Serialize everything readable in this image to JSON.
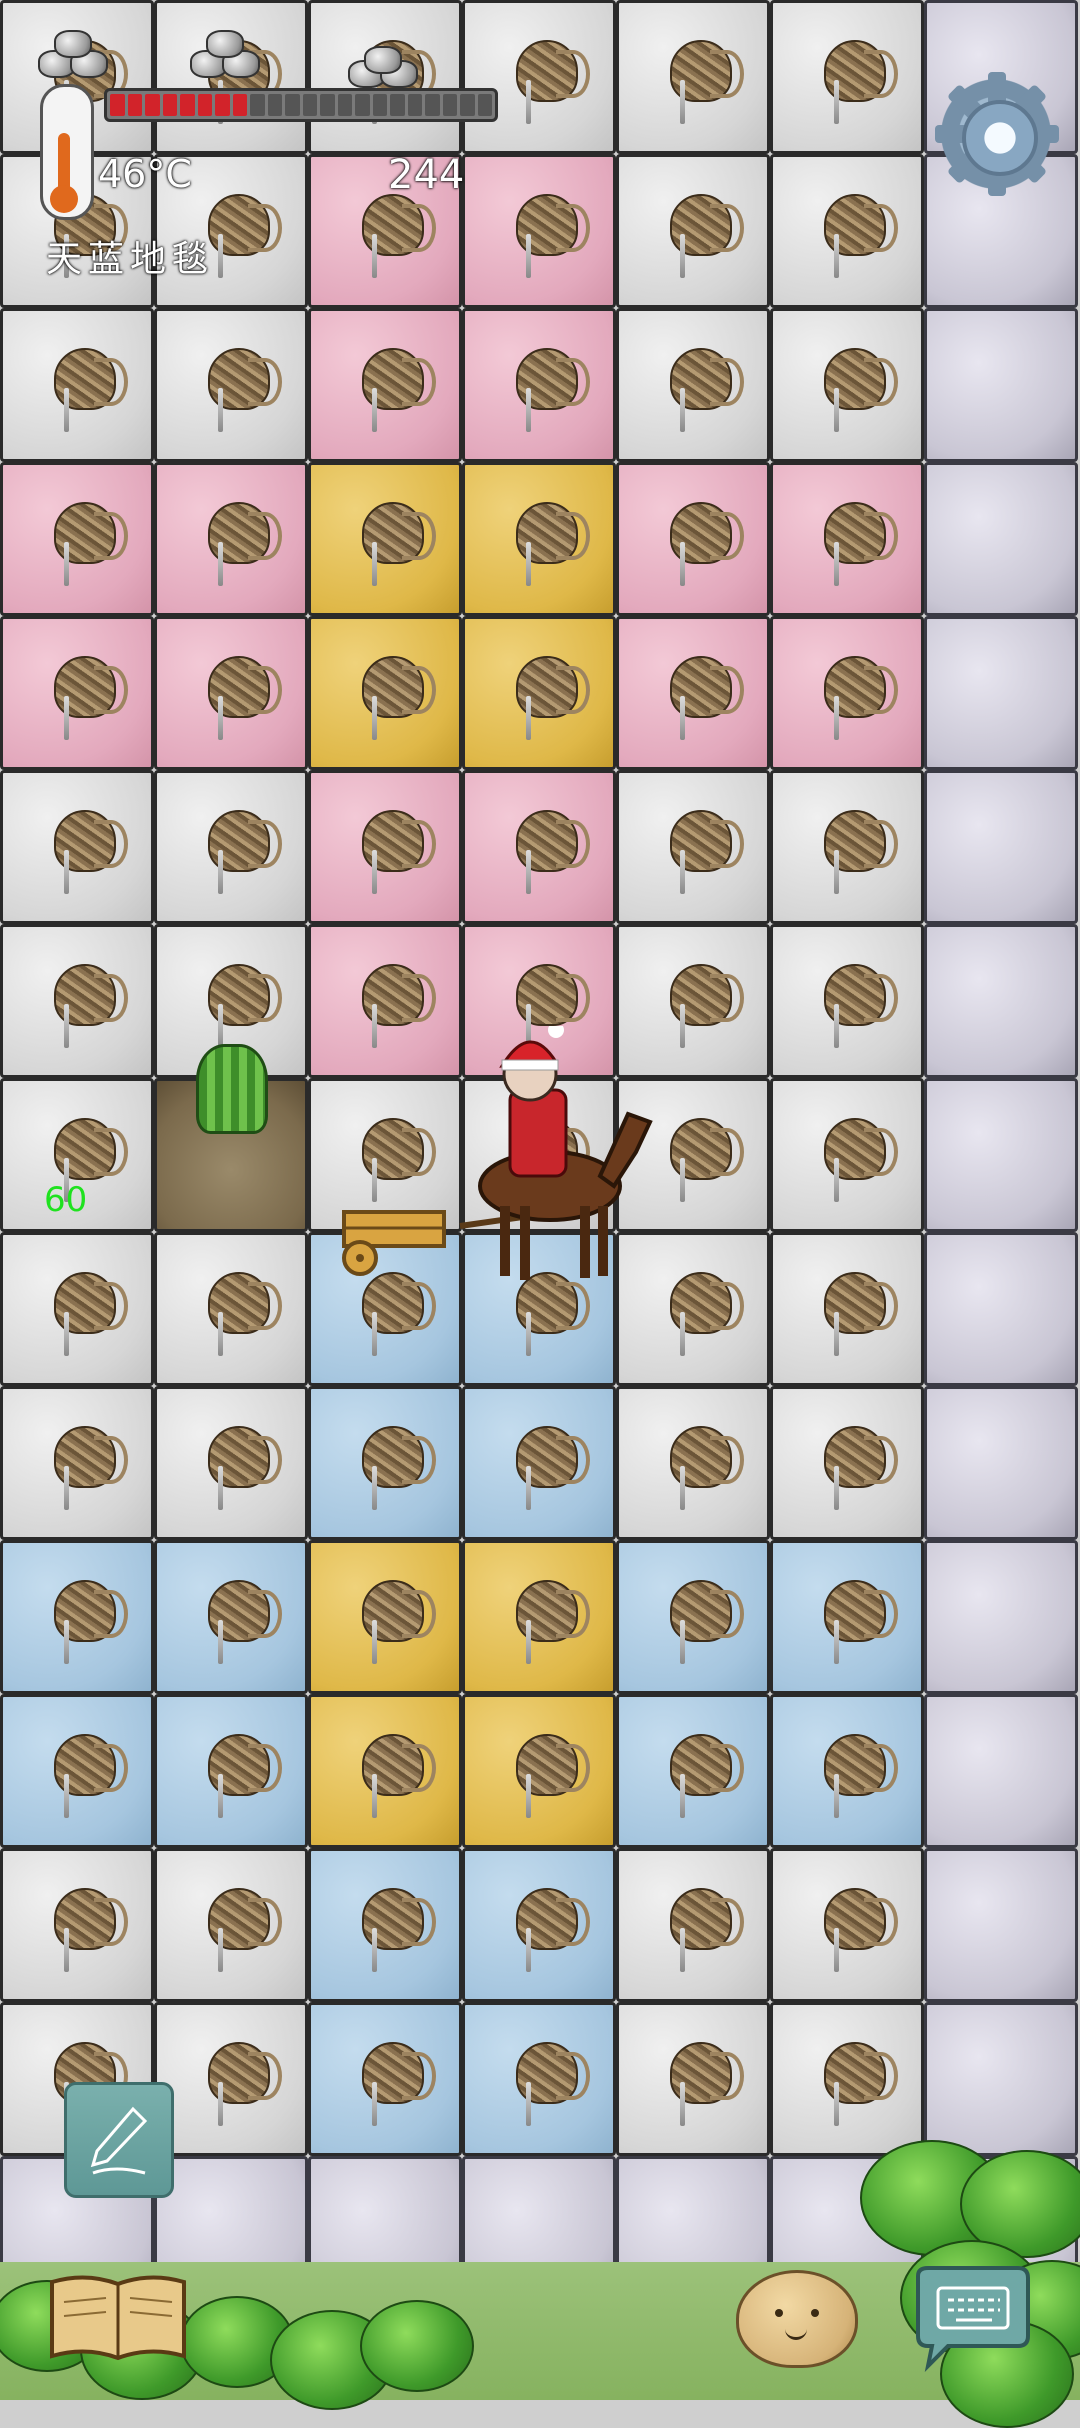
{
  "hud": {
    "temperature": "46°C",
    "yum_value": "244",
    "held_item_name": "天蓝地毯",
    "age": "60",
    "food_meter_fraction": 0.38
  },
  "tile_colors": {
    "white": "#dcdcdc",
    "pink": "#e3a9bd",
    "yellow": "#dfb848",
    "blue": "#a6c6df",
    "stone": "#c9c6d4",
    "grass": "#86b25f"
  },
  "grid_rows": [
    [
      "white",
      "white",
      "white",
      "white",
      "white",
      "white",
      "stone"
    ],
    [
      "white",
      "white",
      "pink",
      "pink",
      "white",
      "white",
      "stone"
    ],
    [
      "white",
      "white",
      "pink",
      "pink",
      "white",
      "white",
      "stone"
    ],
    [
      "pink",
      "pink",
      "yellow",
      "yellow",
      "pink",
      "pink",
      "stone"
    ],
    [
      "pink",
      "pink",
      "yellow",
      "yellow",
      "pink",
      "pink",
      "stone"
    ],
    [
      "white",
      "white",
      "pink",
      "pink",
      "white",
      "white",
      "stone"
    ],
    [
      "white",
      "white",
      "pink",
      "pink",
      "white",
      "white",
      "stone"
    ],
    [
      "white",
      "dirt",
      "white",
      "white",
      "white",
      "white",
      "stone"
    ],
    [
      "white",
      "white",
      "blue",
      "blue",
      "white",
      "white",
      "stone"
    ],
    [
      "white",
      "white",
      "blue",
      "blue",
      "white",
      "white",
      "stone"
    ],
    [
      "blue",
      "blue",
      "yellow",
      "yellow",
      "blue",
      "blue",
      "stone"
    ],
    [
      "blue",
      "blue",
      "yellow",
      "yellow",
      "blue",
      "blue",
      "stone"
    ],
    [
      "white",
      "white",
      "blue",
      "blue",
      "white",
      "white",
      "stone"
    ],
    [
      "white",
      "white",
      "blue",
      "blue",
      "white",
      "white",
      "stone"
    ],
    [
      "stone",
      "stone",
      "stone",
      "stone",
      "stone",
      "stone",
      "stone"
    ]
  ],
  "icons": {
    "settings": "gear-icon",
    "edit": "pencil-icon",
    "recipes": "book-icon",
    "chat": "keyboard-icon",
    "emote": "potato-face-icon",
    "temperature": "thermometer-icon",
    "food": "food-meter"
  }
}
